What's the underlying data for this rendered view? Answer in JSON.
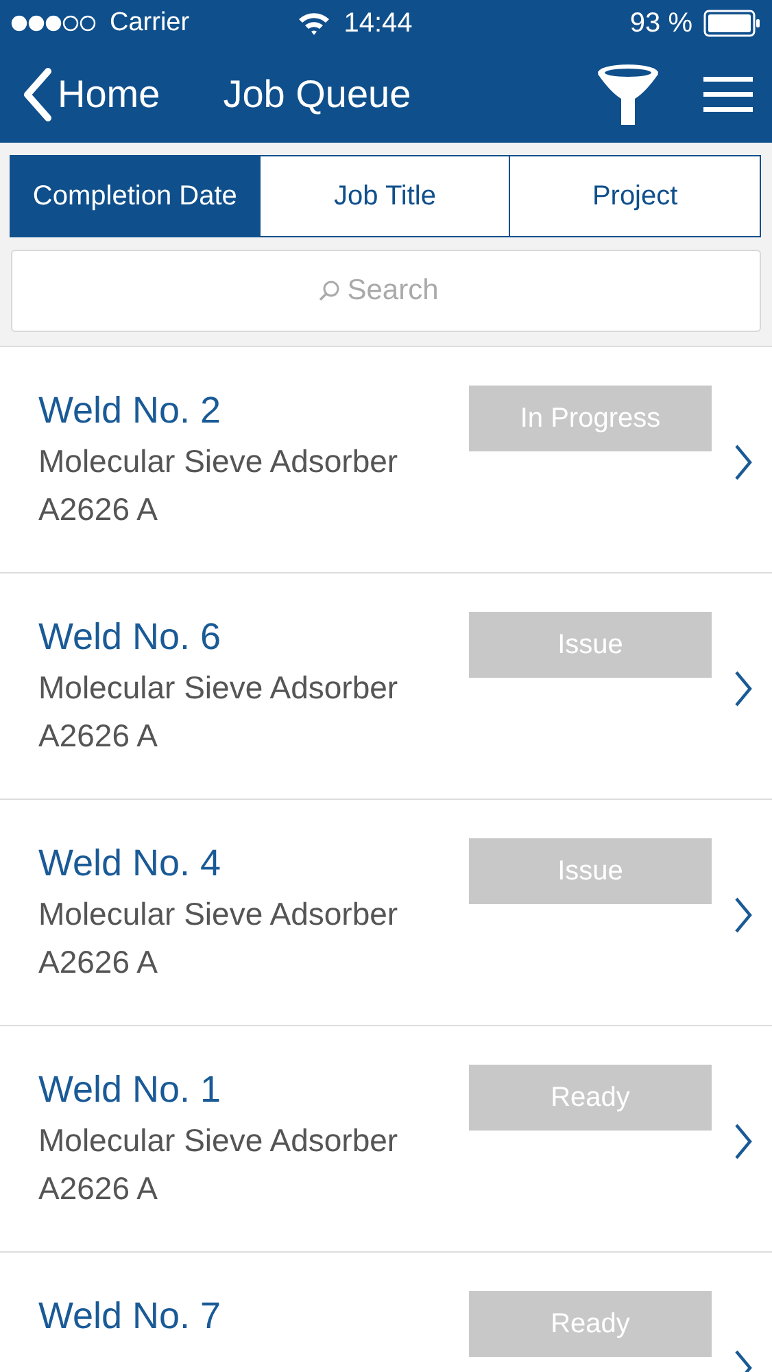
{
  "status_bar": {
    "carrier": "Carrier",
    "time": "14:44",
    "battery": "93 %"
  },
  "nav": {
    "back_label": "Home",
    "title": "Job Queue"
  },
  "sort_tabs": [
    {
      "label": "Completion Date",
      "selected": true
    },
    {
      "label": "Job Title",
      "selected": false
    },
    {
      "label": "Project",
      "selected": false
    }
  ],
  "search": {
    "placeholder": "Search"
  },
  "jobs": [
    {
      "title": "Weld No. 2",
      "subtitle": "Molecular Sieve Adsorber",
      "code": "A2626 A",
      "status": "In Progress"
    },
    {
      "title": "Weld No. 6",
      "subtitle": "Molecular Sieve Adsorber",
      "code": "A2626 A",
      "status": "Issue"
    },
    {
      "title": "Weld No. 4",
      "subtitle": "Molecular Sieve Adsorber",
      "code": "A2626 A",
      "status": "Issue"
    },
    {
      "title": "Weld No. 1",
      "subtitle": "Molecular Sieve Adsorber",
      "code": "A2626 A",
      "status": "Ready"
    },
    {
      "title": "Weld No. 7",
      "status": "Ready"
    }
  ]
}
